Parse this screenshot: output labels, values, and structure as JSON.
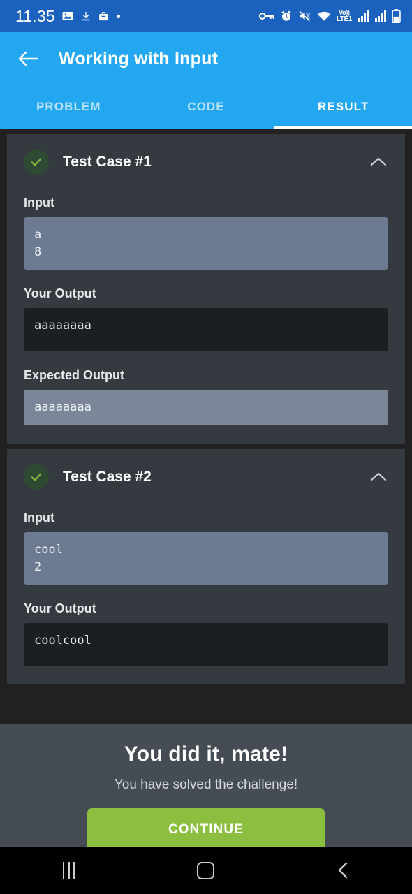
{
  "status_bar": {
    "clock": "11.35",
    "left_icons": [
      "image-icon",
      "download-icon",
      "app-icon",
      "dot-icon"
    ],
    "right_icons": [
      "vpn-key-icon",
      "alarm-icon",
      "mute-vibrate-icon",
      "wifi-icon",
      "signal-bars-icon",
      "signal-bars-icon",
      "battery-icon"
    ],
    "network_label_top": "Vo))",
    "network_label_bottom": "LTE1",
    "background_color": "#1b62be"
  },
  "app_bar": {
    "back_icon": "arrow-left-icon",
    "title": "Working with Input",
    "background_color": "#22a7f0",
    "tabs": [
      {
        "label": "PROBLEM",
        "active": false
      },
      {
        "label": "CODE",
        "active": false
      },
      {
        "label": "RESULT",
        "active": true
      }
    ]
  },
  "result": {
    "test_cases": [
      {
        "title": "Test Case #1",
        "status_icon": "check-icon",
        "status_color": "#8cbf3f",
        "collapse_icon": "chevron-up-icon",
        "fields": [
          {
            "label": "Input",
            "value": "a\n8",
            "style": "input"
          },
          {
            "label": "Your Output",
            "value": "aaaaaaaa",
            "style": "output"
          },
          {
            "label": "Expected Output",
            "value": "aaaaaaaa",
            "style": "expected"
          }
        ]
      },
      {
        "title": "Test Case #2",
        "status_icon": "check-icon",
        "status_color": "#8cbf3f",
        "collapse_icon": "chevron-up-icon",
        "fields": [
          {
            "label": "Input",
            "value": "cool\n2",
            "style": "input"
          },
          {
            "label": "Your Output",
            "value": "coolcool",
            "style": "output"
          }
        ]
      }
    ]
  },
  "success_sheet": {
    "title": "You did it, mate!",
    "subtitle": "You have solved the challenge!",
    "continue_label": "CONTINUE",
    "continue_color": "#8cbf3f",
    "background_color": "#454c54"
  },
  "nav_bar": {
    "recents_icon": "recents-icon",
    "home_icon": "home-icon",
    "back_icon": "back-chevron-icon"
  }
}
